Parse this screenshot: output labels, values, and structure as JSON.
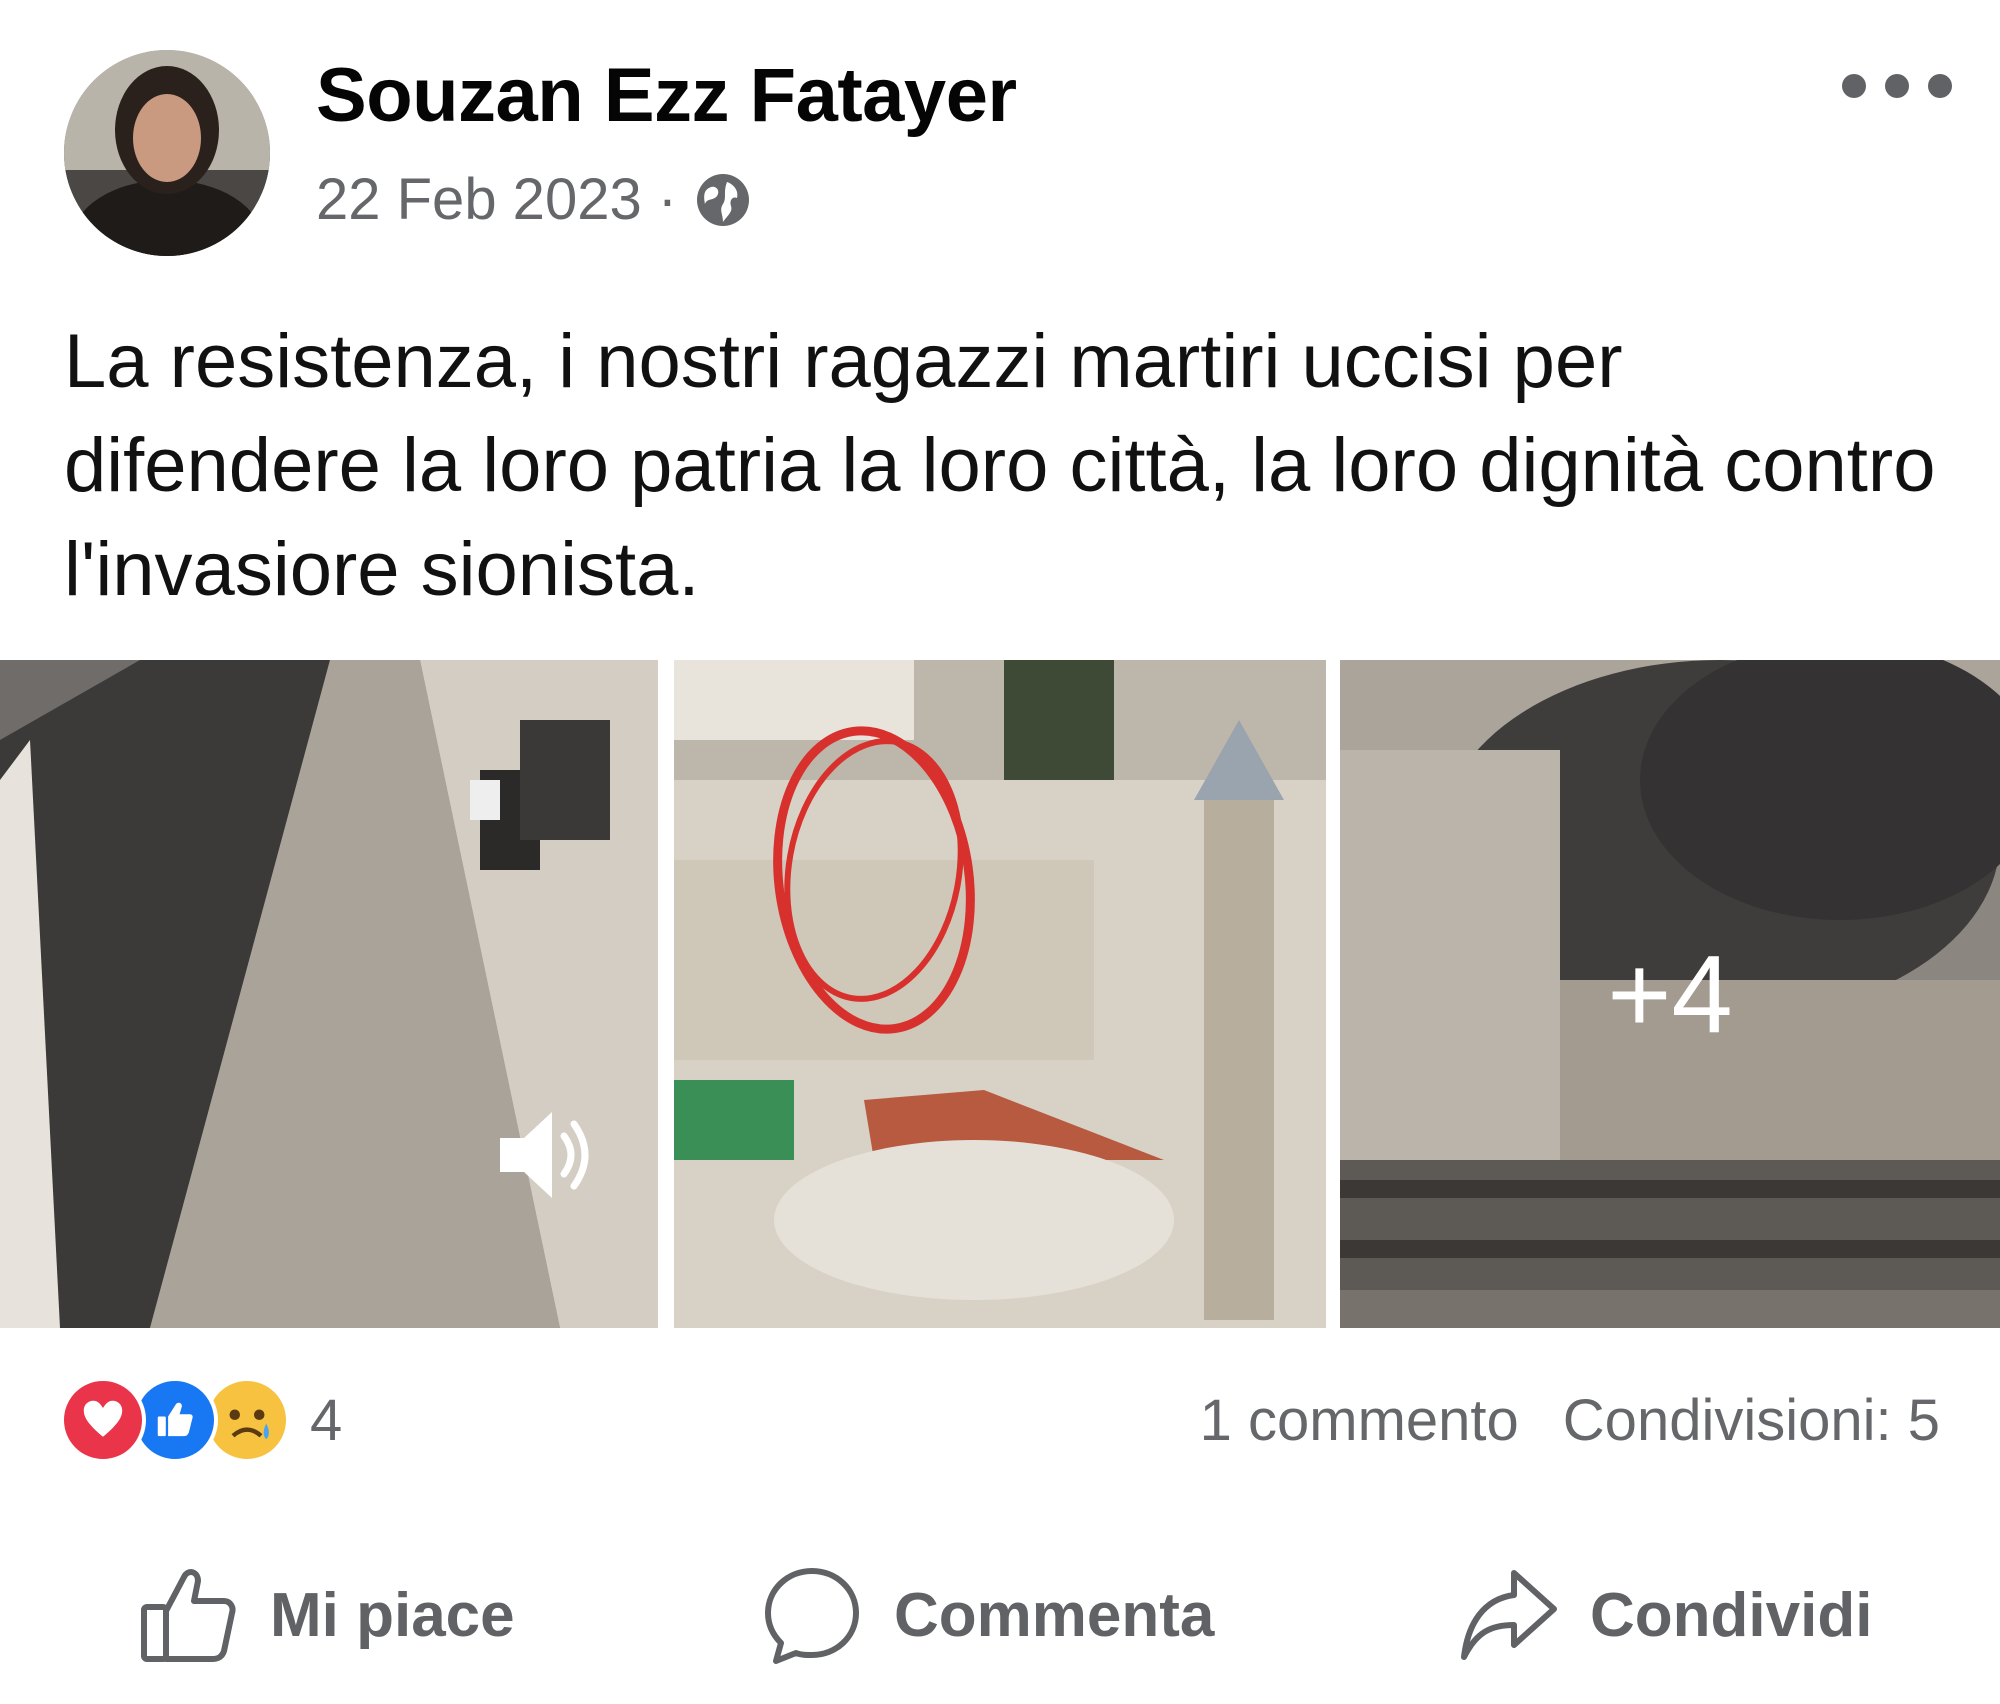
{
  "post": {
    "author": "Souzan Ezz Fatayer",
    "date": "22 Feb 2023",
    "separator": "·",
    "audience_icon": "globe-icon",
    "text": "La resistenza, i nostri ragazzi martiri uccisi per difendere la loro patria la loro città, la loro dignità contro l'invasiore sionista."
  },
  "media": {
    "more_count": "+4",
    "tiles": [
      {
        "kind": "video",
        "icon": "speaker-icon"
      },
      {
        "kind": "photo",
        "annotation": "red-circle"
      },
      {
        "kind": "photo"
      }
    ]
  },
  "stats": {
    "reaction_icons": [
      "love-icon",
      "like-icon",
      "sad-icon"
    ],
    "reaction_count": "4",
    "comments": "1 commento",
    "shares": "Condivisioni: 5"
  },
  "actions": {
    "like": "Mi piace",
    "comment": "Commenta",
    "share": "Condividi"
  },
  "colors": {
    "text": "#050505",
    "secondary": "#65676b",
    "love": "#e9344a",
    "like": "#1877f2",
    "sad": "#f7c23f"
  }
}
